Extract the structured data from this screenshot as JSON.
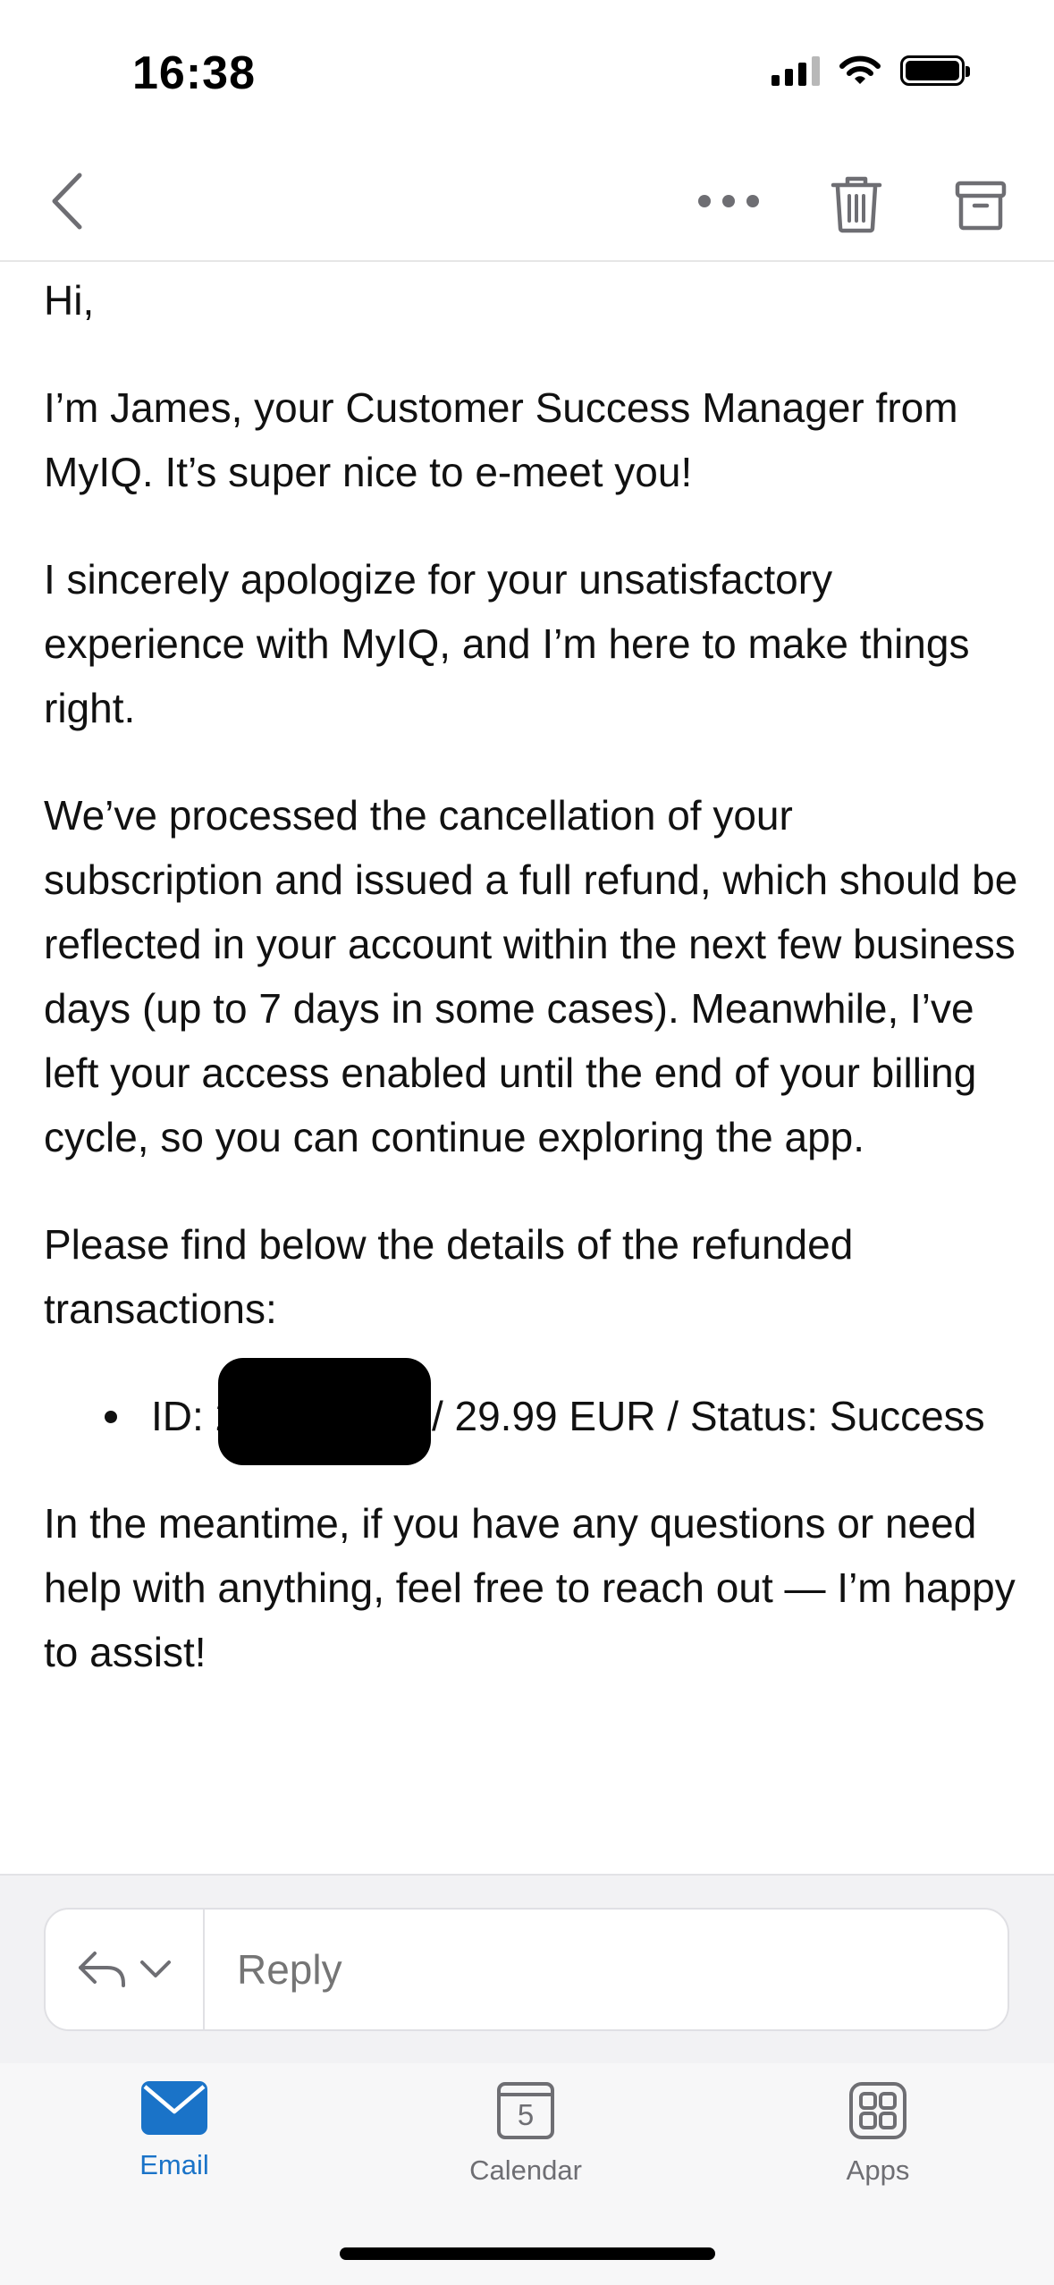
{
  "status_bar": {
    "time": "16:38"
  },
  "toolbar": {
    "back_icon": "chevron-left-icon",
    "more_icon": "ellipsis-icon",
    "trash_icon": "trash-icon",
    "archive_icon": "archive-icon"
  },
  "email": {
    "greeting": "Hi,",
    "paragraph_1": "I’m James, your Customer Success Manager from MyIQ. It’s super nice to e-meet you!",
    "paragraph_2": "I sincerely apologize for your unsatisfactory experience with MyIQ, and I’m here to make things right.",
    "paragraph_3": "We’ve processed the cancellation of your subscription and issued a full refund, which should be reflected in your account within the next few business days (up to 7 days in some cases). Meanwhile, I’ve left your access enabled until the end of your billing cycle, so you can continue exploring the app.",
    "paragraph_4": "Please find below the details of the refunded transactions:",
    "transaction": {
      "id_prefix": "ID: 2",
      "id_suffix": "",
      "details": "/ 29.99 EUR / Status: Success"
    },
    "paragraph_5": "In the meantime, if you have any questions or need help with anything, feel free to reach out — I’m happy to assist!"
  },
  "reply": {
    "placeholder": "Reply"
  },
  "tabs": [
    {
      "label": "Email",
      "active": true
    },
    {
      "label": "Calendar",
      "active": false,
      "day": "5"
    },
    {
      "label": "Apps",
      "active": false
    }
  ],
  "colors": {
    "accent": "#1a73c8",
    "icon_gray": "#6e6e73"
  }
}
